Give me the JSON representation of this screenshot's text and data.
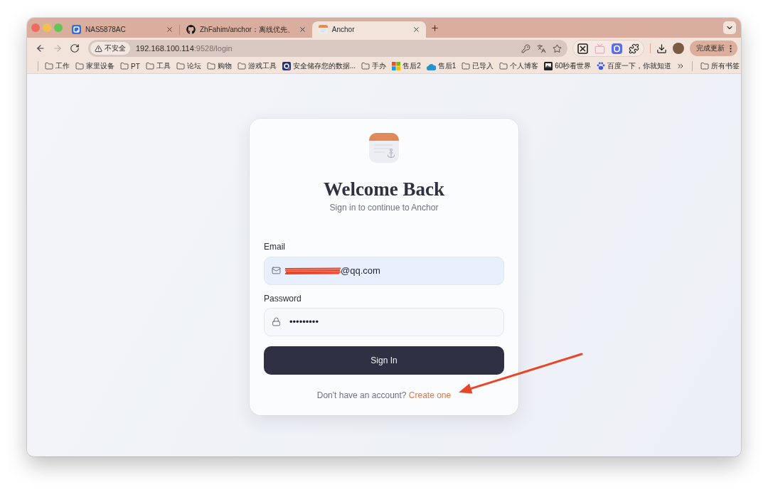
{
  "tabs": [
    {
      "kind": "nas",
      "title": "NAS5878AC",
      "selected": false
    },
    {
      "kind": "github",
      "title": "ZhFahim/anchor：离线优先、",
      "selected": false
    },
    {
      "kind": "notepad",
      "title": "Anchor",
      "selected": true
    }
  ],
  "toolbar": {
    "nav_buttons": [
      {
        "kind": "back",
        "disabled": false
      },
      {
        "kind": "forward",
        "disabled": true
      },
      {
        "kind": "reload",
        "disabled": false
      }
    ],
    "address_bar": {
      "security_label": "不安全",
      "host": "192.168.100.114",
      "path": ":9528/login"
    },
    "update_button": "完成更新"
  },
  "bookmarks_bar": {
    "items": [
      {
        "kind": "folder",
        "label": "工作"
      },
      {
        "kind": "folder",
        "label": "家里设备"
      },
      {
        "kind": "folder",
        "label": "PT"
      },
      {
        "kind": "folder",
        "label": "工具"
      },
      {
        "kind": "folder",
        "label": "论坛"
      },
      {
        "kind": "folder",
        "label": "购物"
      },
      {
        "kind": "folder",
        "label": "游戏工具"
      },
      {
        "kind": "vault",
        "label": "安全储存您的数据..."
      },
      {
        "kind": "folder",
        "label": "手办"
      },
      {
        "kind": "windows",
        "label": "售后2"
      },
      {
        "kind": "cloud",
        "label": "售后1"
      },
      {
        "kind": "folder",
        "label": "已导入"
      },
      {
        "kind": "folder",
        "label": "个人博客"
      },
      {
        "kind": "photo",
        "label": "60秒看世界"
      },
      {
        "kind": "paw",
        "label": "百度一下，你就知道"
      }
    ],
    "all_bookmarks": "所有书签"
  },
  "login_card": {
    "title": "Welcome Back",
    "subtitle": "Sign in to continue to Anchor",
    "fields": [
      {
        "kind": "email",
        "label": "Email",
        "value": "@qq.com",
        "redacted": true,
        "autofilled": true
      },
      {
        "kind": "password",
        "label": "Password",
        "value": "•••••••••",
        "redacted": false,
        "autofilled": false
      }
    ],
    "submit": "Sign In",
    "footer": {
      "text": "Don't have an account?",
      "link": "Create one"
    }
  },
  "annotations": [
    {
      "kind": "arrow"
    }
  ]
}
